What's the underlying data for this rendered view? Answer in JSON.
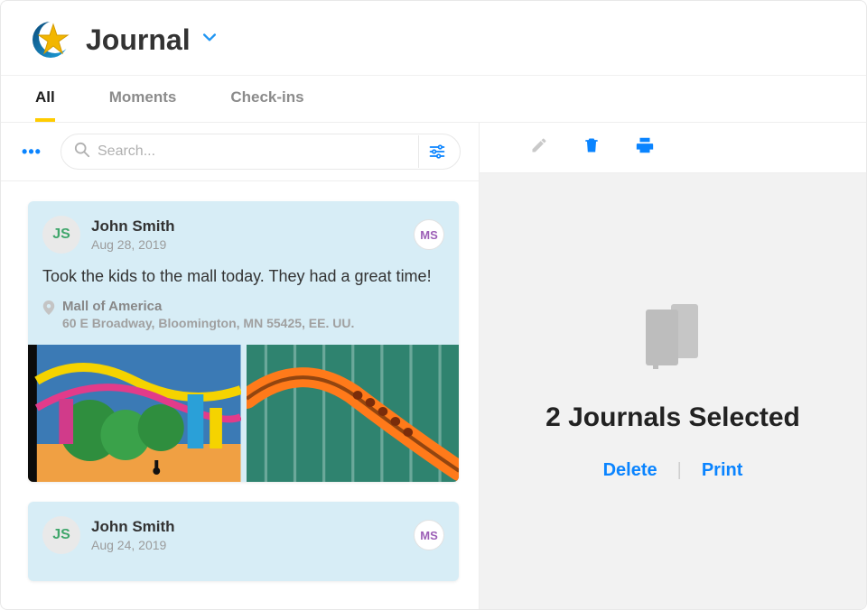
{
  "header": {
    "title": "Journal"
  },
  "tabs": [
    {
      "label": "All",
      "active": true
    },
    {
      "label": "Moments",
      "active": false
    },
    {
      "label": "Check-ins",
      "active": false
    }
  ],
  "search": {
    "placeholder": "Search..."
  },
  "entries": [
    {
      "initials": "JS",
      "name": "John Smith",
      "date": "Aug 28, 2019",
      "badge": "MS",
      "body": "Took the kids to the mall today. They had a great time!",
      "location": {
        "name": "Mall of America",
        "address": "60 E Broadway, Bloomington, MN 55425, EE. UU."
      }
    },
    {
      "initials": "JS",
      "name": "John Smith",
      "date": "Aug 24, 2019",
      "badge": "MS"
    }
  ],
  "selection": {
    "count_text": "2 Journals Selected",
    "actions": {
      "delete": "Delete",
      "print": "Print"
    }
  },
  "colors": {
    "accent": "#0a84ff",
    "tab_underline": "#ffcc00",
    "entry_bg": "#d7edf6"
  }
}
